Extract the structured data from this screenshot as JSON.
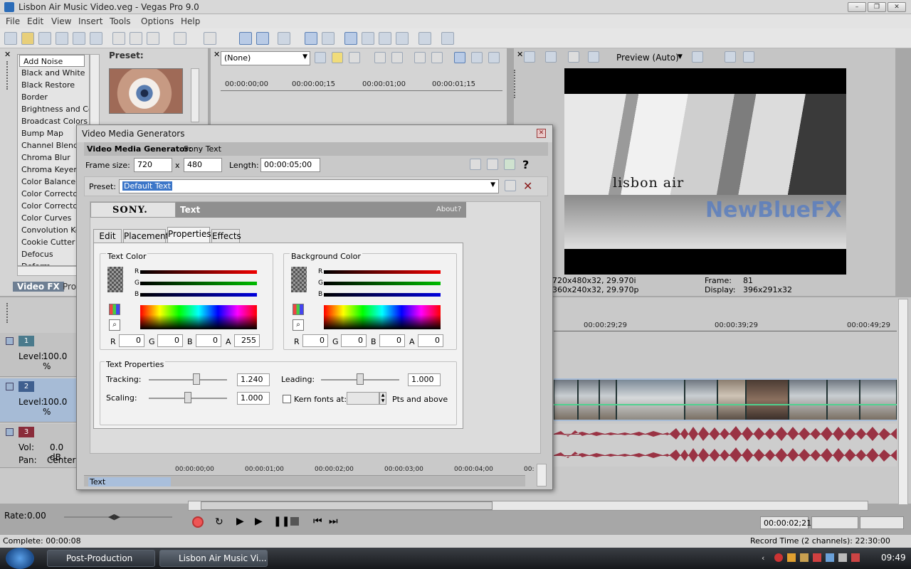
{
  "window": {
    "title": "Lisbon Air Music Video.veg - Vegas Pro 9.0"
  },
  "menu": [
    "File",
    "Edit",
    "View",
    "Insert",
    "Tools",
    "Options",
    "Help"
  ],
  "fx_panel": {
    "preset_label": "Preset:",
    "items": [
      "Add Noise",
      "Black and White",
      "Black Restore",
      "Border",
      "Brightness and Contrast",
      "Broadcast Colors",
      "Bump Map",
      "Channel Blend",
      "Chroma Blur",
      "Chroma Keyer",
      "Color Balance",
      "Color Corrector",
      "Color Corrector",
      "Color Curves",
      "Convolution Kernel",
      "Cookie Cutter",
      "Defocus",
      "Deform"
    ],
    "tabs": [
      "Video FX",
      "Pro"
    ]
  },
  "trimmer": {
    "preset_select": "(None)",
    "ruler": [
      "00:00:00;00",
      "00:00:00;15",
      "00:00:01;00",
      "00:00:01;15"
    ]
  },
  "preview": {
    "mode": "Preview (Auto)",
    "title_text": "lisbon air",
    "watermark": "NewBlueFX",
    "project_info": "720x480x32, 29.970i",
    "preview_info": "360x240x32, 29.970p",
    "frame_label": "Frame:",
    "frame_value": "81",
    "display_label": "Display:",
    "display_value": "396x291x32"
  },
  "dialog": {
    "title": "Video Media Generators",
    "generator_label": "Video Media Generator:",
    "generator_name": "Sony Text",
    "frame_size_label": "Frame size:",
    "frame_w": "720",
    "x_label": "x",
    "frame_h": "480",
    "length_label": "Length:",
    "length": "00:00:05;00",
    "help_glyph": "?",
    "preset_label": "Preset:",
    "preset_value": "Default Text",
    "plugin_brand": "SONY.",
    "plugin_name": "Text",
    "about": "About",
    "about_q": "?",
    "tabs": [
      "Edit",
      "Placement",
      "Properties",
      "Effects"
    ],
    "text_color": {
      "title": "Text Color",
      "r": "0",
      "g": "0",
      "b": "0",
      "a": "255"
    },
    "bg_color": {
      "title": "Background Color",
      "r": "0",
      "g": "0",
      "b": "0",
      "a": "0"
    },
    "channel_labels": {
      "r": "R",
      "g": "G",
      "b": "B",
      "a": "A"
    },
    "text_props": {
      "title": "Text Properties",
      "tracking_label": "Tracking:",
      "tracking": "1.240",
      "leading_label": "Leading:",
      "leading": "1.000",
      "scaling_label": "Scaling:",
      "scaling": "1.000",
      "kern_label": "Kern fonts at:",
      "kern_suffix": "Pts and above"
    },
    "keyframe_ruler": [
      "00:00:00;00",
      "00:00:01;00",
      "00:00:02;00",
      "00:00:03;00",
      "00:00:04;00",
      "00:"
    ],
    "keyframe_track": "Text"
  },
  "timeline": {
    "ruler": [
      "00:00:29;29",
      "00:00:39;29",
      "00:00:49;29"
    ],
    "tracks": [
      {
        "num": "1",
        "label": "Level:",
        "value": "100.0 %",
        "color": "#4a7a8c"
      },
      {
        "num": "2",
        "label": "Level:",
        "value": "100.0 %",
        "color": "#3f5f8f"
      },
      {
        "num": "3",
        "vol_label": "Vol:",
        "vol": "0.0 dB",
        "pan_label": "Pan:",
        "pan": "Center",
        "color": "#8a2c3a"
      }
    ],
    "rate_label": "Rate:",
    "rate": "0.00",
    "cursor_time": "00:00:02;21"
  },
  "status": {
    "complete": "Complete: 00:00:08",
    "record_time": "Record Time (2 channels): 22:30:00"
  },
  "taskbar": {
    "buttons": [
      "Post-Production",
      "Lisbon Air Music Vi..."
    ],
    "clock": "09:49"
  }
}
